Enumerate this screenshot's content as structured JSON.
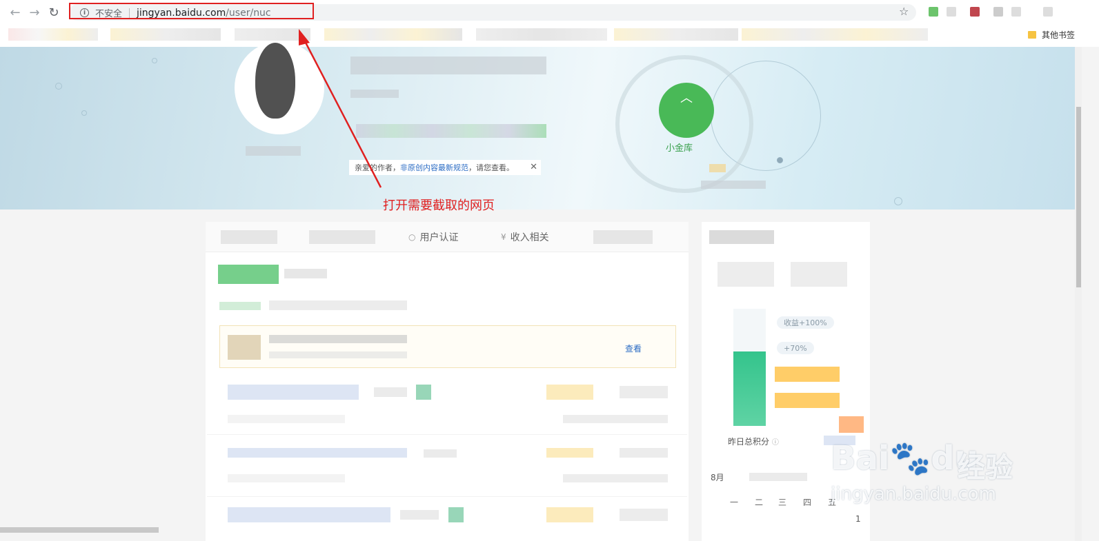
{
  "browser": {
    "insecure_label": "不安全",
    "url_host": "jingyan.baidu.com",
    "url_path": "/user/nuc",
    "other_bookmarks": "其他书签"
  },
  "banner": {
    "notice_prefix": "亲爱的作者，",
    "notice_link": "非原创内容最新规范",
    "notice_suffix": "，请您查看。",
    "coin_label": "小金库",
    "annotation": "打开需要截取的网页"
  },
  "tabs": [
    {
      "label": "用户认证",
      "icon": "shield-icon"
    },
    {
      "label": "收入相关",
      "icon": "yen-icon"
    }
  ],
  "main": {
    "view_link": "查看"
  },
  "side": {
    "tag1": "收益+100%",
    "tag2": "+70%",
    "yesterday": "昨日总积分",
    "month": "8月",
    "weekdays": [
      "一",
      "二",
      "三",
      "四",
      "五"
    ],
    "first_day": "1"
  },
  "watermark": {
    "brand": "Bai",
    "brand2": "du",
    "cn": "经验",
    "site": "jingyan.baidu.com"
  }
}
